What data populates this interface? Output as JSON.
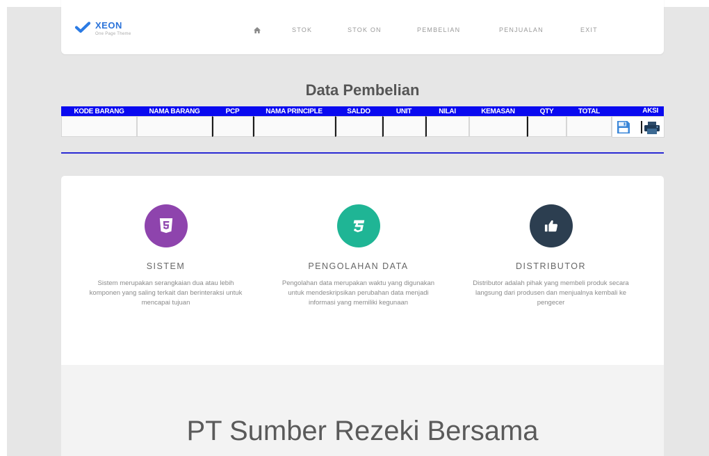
{
  "navbar": {
    "brand": "XEON",
    "brand_tagline": "One Page Theme",
    "logo_icon": "check-icon",
    "home_icon": "home-icon",
    "items": [
      "STOK",
      "STOK ON",
      "PEMBELIAN",
      "PENJUALAN",
      "EXIT"
    ]
  },
  "page_title": "Data Pembelian",
  "purchase_table": {
    "headers": [
      "KODE BARANG",
      "NAMA BARANG",
      "PCP",
      "NAMA PRINCIPLE",
      "SALDO",
      "UNIT",
      "NILAI",
      "KEMASAN",
      "QTY",
      "TOTAL",
      "AKSI"
    ],
    "input_values": [
      "",
      "",
      "",
      "",
      "",
      "",
      "",
      "",
      "",
      ""
    ],
    "actions": [
      {
        "name": "save",
        "icon": "save-icon"
      },
      {
        "name": "print",
        "icon": "print-icon"
      }
    ]
  },
  "features": [
    {
      "title": "SISTEM",
      "description": "Sistem merupakan serangkaian dua atau lebih komponen yang saling terkait dan berinteraksi untuk mencapai tujuan",
      "icon": "html5-icon",
      "color": "#8e44ad"
    },
    {
      "title": "PENGOLAHAN DATA",
      "description": "Pengolahan data merupakan waktu yang digunakan untuk mendeskripsikan perubahan data menjadi informasi yang memiliki kegunaan",
      "icon": "css3-icon",
      "color": "#1fb595"
    },
    {
      "title": "DISTRIBUTOR",
      "description": "Distributor adalah pihak yang membeli produk secara langsung dari produsen dan menjualnya kembali ke pengecer",
      "icon": "thumbs-up-icon",
      "color": "#2c3e50"
    }
  ],
  "footer": {
    "company_name": "PT Sumber Rezeki Bersama"
  },
  "colors": {
    "page_background": "#e6e6e6",
    "brand": "#2b73d9",
    "table_header": "#0a0af0",
    "divider": "#2a2ad4"
  }
}
